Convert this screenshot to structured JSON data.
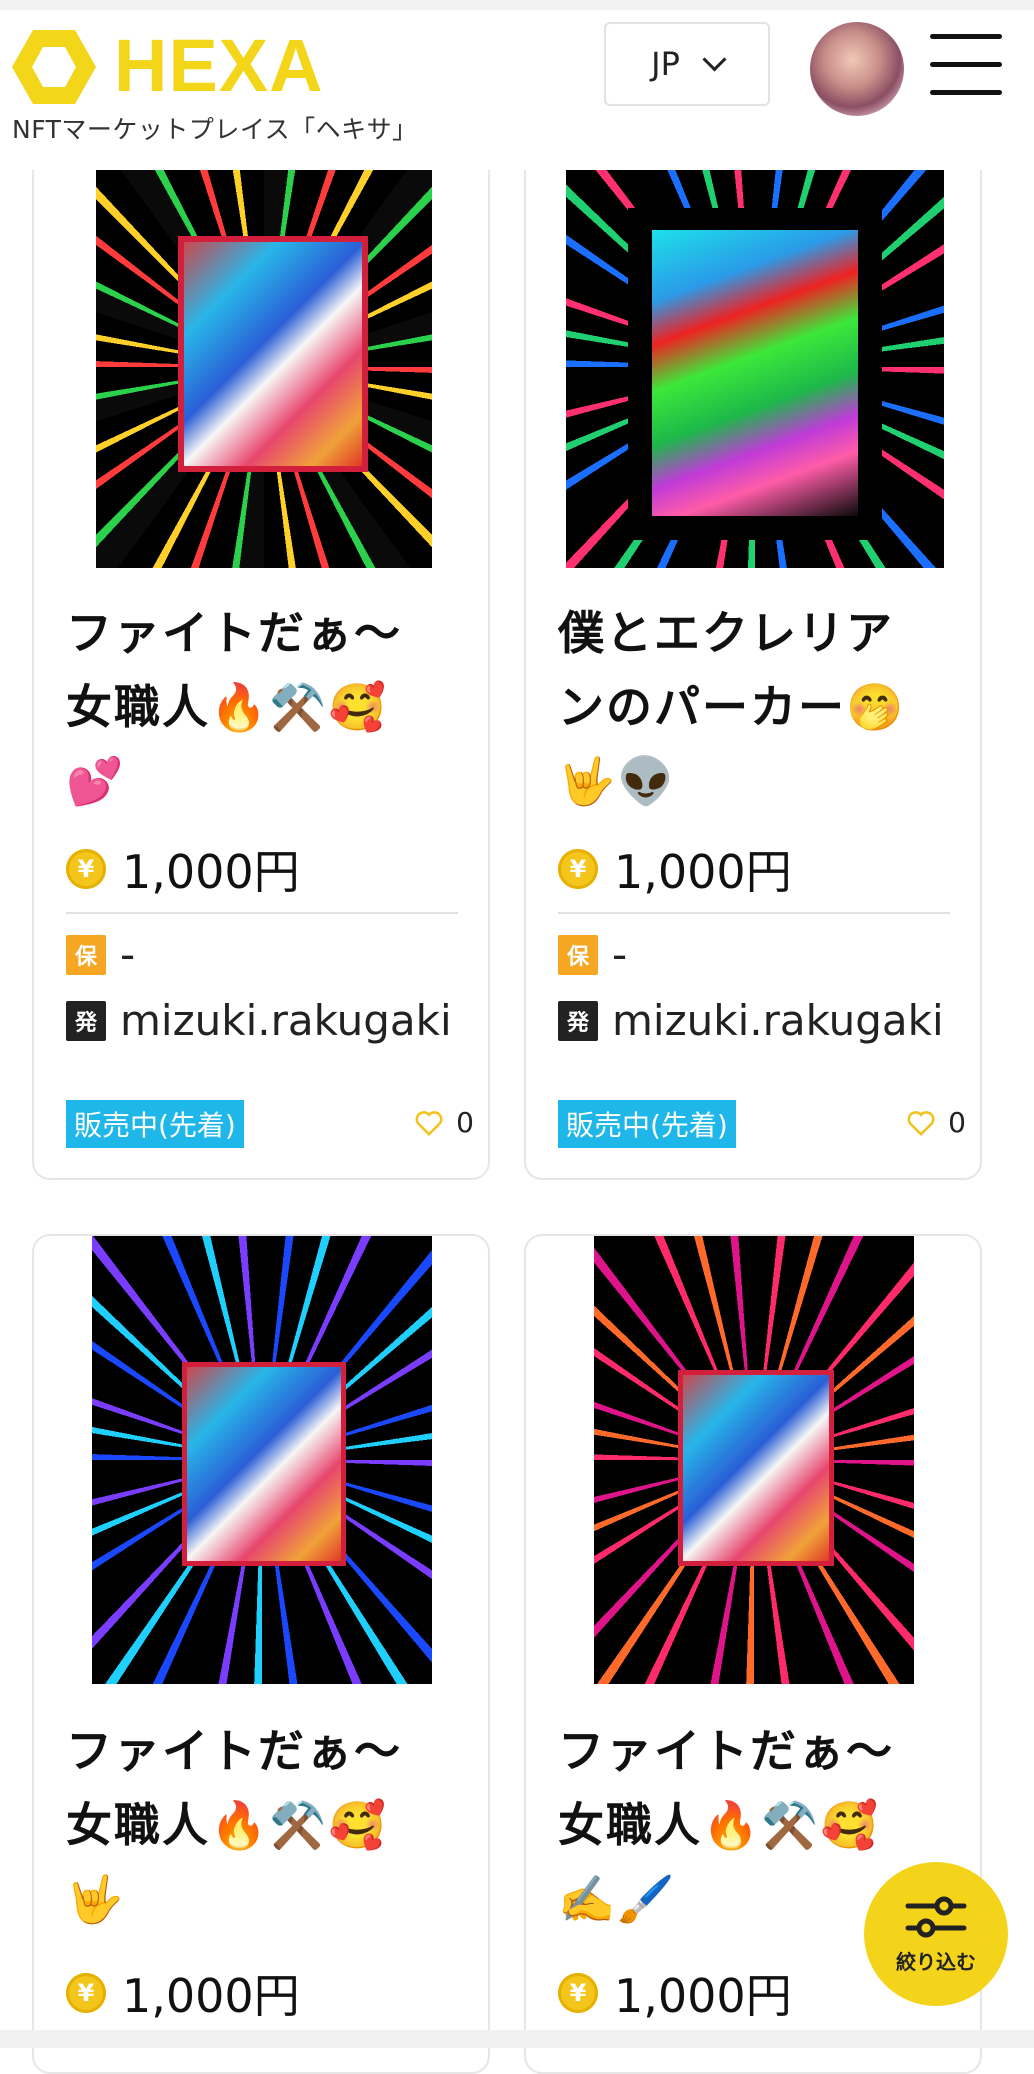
{
  "header": {
    "logo_text": "HEXA",
    "tagline": "NFTマーケットプレイス「ヘキサ」",
    "language": "JP"
  },
  "colors": {
    "brand_yellow": "#f3d51a",
    "status_blue": "#1fb7ea",
    "hold_badge": "#f5a623",
    "heart_outline": "#f2c21a"
  },
  "icons": {
    "coin": "yen-coin-icon",
    "hold_badge": "hold-badge-icon",
    "issuer_badge": "issuer-badge-icon",
    "like": "heart-icon",
    "menu": "hamburger-menu-icon",
    "filter": "sliders-icon"
  },
  "cards": [
    {
      "title": "ファイトだぁ〜\n女職人🔥⚒️🥰\n💕",
      "coin_glyph": "¥",
      "price": "1,000円",
      "hold_badge": "保",
      "holder": "-",
      "issuer_badge": "発",
      "issuer": "mizuki.rakugaki",
      "status": "販売中(先着)",
      "likes": "0"
    },
    {
      "title": "僕とエクレリア\nンのパーカー🤭\n🤟👽",
      "coin_glyph": "¥",
      "price": "1,000円",
      "hold_badge": "保",
      "holder": "-",
      "issuer_badge": "発",
      "issuer": "mizuki.rakugaki",
      "status": "販売中(先着)",
      "likes": "0"
    },
    {
      "title": "ファイトだぁ〜\n女職人🔥⚒️🥰\n🤟",
      "coin_glyph": "¥",
      "price": "1,000円"
    },
    {
      "title": "ファイトだぁ〜\n女職人🔥⚒️🥰\n✍️🖌️",
      "coin_glyph": "¥",
      "price": "1,000円"
    }
  ],
  "filter_button": {
    "label": "絞り込む"
  }
}
